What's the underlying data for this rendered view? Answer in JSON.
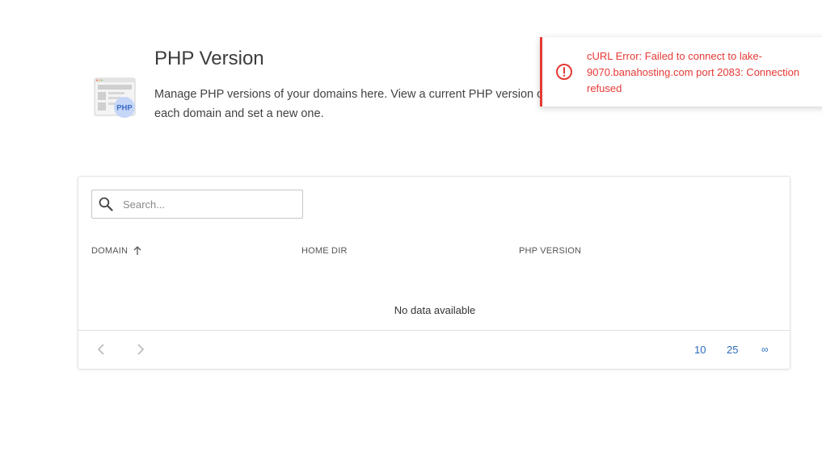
{
  "header": {
    "title": "PHP Version",
    "description": "Manage PHP versions of your domains here. View a current PHP version of each domain and set a new one.",
    "icon": "php-icon",
    "icon_badge": "PHP"
  },
  "search": {
    "placeholder": "Search...",
    "value": "",
    "icon": "search-icon"
  },
  "table": {
    "columns": [
      "DOMAIN",
      "HOME DIR",
      "PHP VERSION"
    ],
    "sort_column": "DOMAIN",
    "sort_direction": "ascending",
    "rows": [],
    "empty_text": "No data available"
  },
  "pagination": {
    "prev_icon": "chevron-left-icon",
    "next_icon": "chevron-right-icon",
    "page_sizes": [
      "10",
      "25",
      "∞"
    ]
  },
  "toast": {
    "type": "error",
    "icon": "error-circle-icon",
    "message": "cURL Error: Failed to connect to lake-9070.banahosting.com port 2083: Connection refused"
  },
  "colors": {
    "accent": "#2b6bb8",
    "error": "#e53935",
    "php_badge": "#c5d6f7"
  }
}
